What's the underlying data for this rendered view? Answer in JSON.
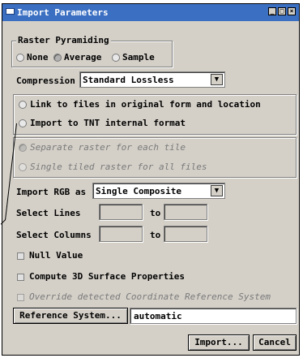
{
  "window": {
    "title": "Import Parameters"
  },
  "raster_pyramiding": {
    "legend": "Raster Pyramiding",
    "options": [
      {
        "label": "None",
        "selected": false
      },
      {
        "label": "Average",
        "selected": true
      },
      {
        "label": "Sample",
        "selected": false
      }
    ]
  },
  "compression": {
    "label": "Compression",
    "value": "Standard Lossless"
  },
  "link_group": {
    "link_label": "Link to files in original form and location",
    "import_label": "Import to TNT internal format"
  },
  "tile_group": {
    "separate_label": "Separate raster for each tile",
    "single_label": "Single tiled raster for all files"
  },
  "import_rgb": {
    "label": "Import RGB as",
    "value": "Single Composite"
  },
  "select_lines": {
    "label": "Select Lines",
    "to": "to",
    "from_value": "",
    "to_value": ""
  },
  "select_columns": {
    "label": "Select Columns",
    "to": "to",
    "from_value": "",
    "to_value": ""
  },
  "null_value": {
    "label": "Null Value"
  },
  "compute_3d": {
    "label": "Compute 3D Surface Properties"
  },
  "override_crs": {
    "label": "Override detected Coordinate Reference System"
  },
  "reference_system": {
    "button_label": "Reference System...",
    "value": "automatic"
  },
  "footer": {
    "import_label": "Import...",
    "cancel_label": "Cancel"
  }
}
